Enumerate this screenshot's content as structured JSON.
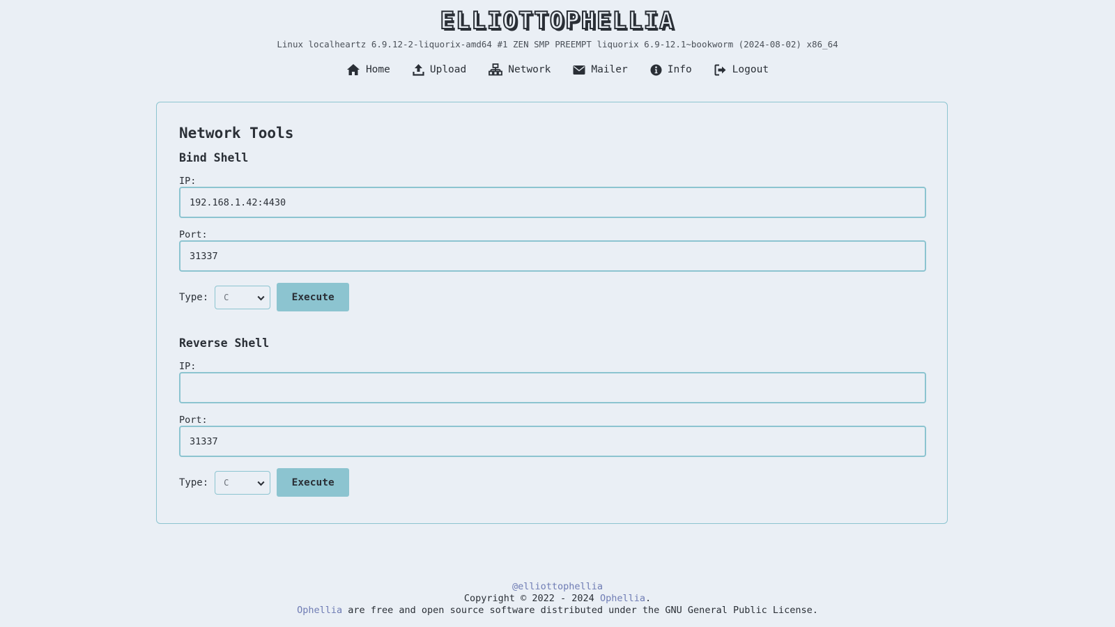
{
  "header": {
    "brand": "ELLIOTTOPHELLIA",
    "kernel": "Linux localheartz 6.9.12-2-liquorix-amd64 #1 ZEN SMP PREEMPT liquorix 6.9-12.1~bookworm (2024-08-02) x86_64"
  },
  "nav": {
    "items": [
      {
        "label": "Home",
        "icon": "home-icon"
      },
      {
        "label": "Upload",
        "icon": "upload-icon"
      },
      {
        "label": "Network",
        "icon": "network-icon"
      },
      {
        "label": "Mailer",
        "icon": "envelope-icon"
      },
      {
        "label": "Info",
        "icon": "info-icon"
      },
      {
        "label": "Logout",
        "icon": "logout-icon"
      }
    ]
  },
  "main": {
    "title": "Network Tools",
    "bind": {
      "heading": "Bind Shell",
      "ip_label": "IP:",
      "ip_value": "192.168.1.42:4430",
      "port_label": "Port:",
      "port_value": "31337",
      "type_label": "Type:",
      "type_selected": "C",
      "execute_label": "Execute"
    },
    "reverse": {
      "heading": "Reverse Shell",
      "ip_label": "IP:",
      "ip_value": "",
      "port_label": "Port:",
      "port_value": "31337",
      "type_label": "Type:",
      "type_selected": "C",
      "execute_label": "Execute"
    }
  },
  "footer": {
    "handle": "@elliottophellia",
    "copyright_prefix": "Copyright © 2022 - 2024 ",
    "copyright_link": "Ophellia",
    "copyright_suffix": ".",
    "license_link": "Ophellia",
    "license_text": " are free and open source software distributed under the GNU General Public License."
  },
  "colors": {
    "background": "#eaeff5",
    "accent": "#8cc4d0",
    "text": "#2a2f36",
    "link": "#6f7cb4"
  }
}
